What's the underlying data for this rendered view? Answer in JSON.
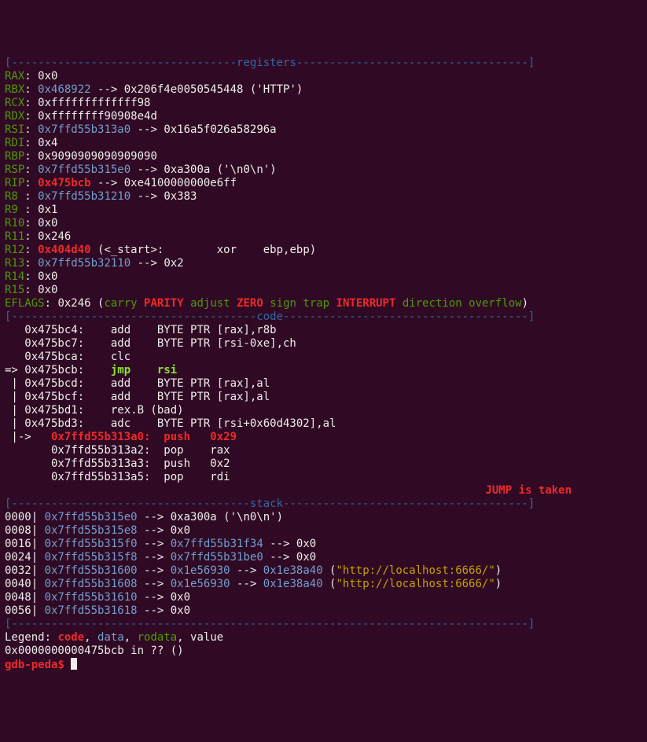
{
  "headers": {
    "registers": "registers",
    "code": "code",
    "stack": "stack"
  },
  "registers": [
    {
      "name": "RAX",
      "sep": ": ",
      "plain": "0x0"
    },
    {
      "name": "RBX",
      "sep": ": ",
      "addr": "0x468922",
      "tail": " --> 0x206f4e0050545448 ('HTTP')"
    },
    {
      "name": "RCX",
      "sep": ": ",
      "plain": "0xfffffffffffff98"
    },
    {
      "name": "RDX",
      "sep": ": ",
      "plain": "0xffffffff90908e4d"
    },
    {
      "name": "RSI",
      "sep": ": ",
      "addr": "0x7ffd55b313a0",
      "tail": " --> 0x16a5f026a58296a"
    },
    {
      "name": "RDI",
      "sep": ": ",
      "plain": "0x4"
    },
    {
      "name": "RBP",
      "sep": ": ",
      "plain": "0x9090909090909090"
    },
    {
      "name": "RSP",
      "sep": ": ",
      "addr": "0x7ffd55b315e0",
      "tail": " --> 0xa300a ('\\n0\\n')"
    },
    {
      "name": "RIP",
      "sep": ": ",
      "red": "0x475bcb",
      "tail": " --> 0xe4100000000e6ff"
    },
    {
      "name": "R8 ",
      "sep": ": ",
      "addr": "0x7ffd55b31210",
      "tail": " --> 0x383"
    },
    {
      "name": "R9 ",
      "sep": ": ",
      "plain": "0x1"
    },
    {
      "name": "R10",
      "sep": ": ",
      "plain": "0x0"
    },
    {
      "name": "R11",
      "sep": ": ",
      "plain": "0x246"
    },
    {
      "name": "R12",
      "sep": ": ",
      "red": "0x404d40",
      "tail": " (<_start>:        xor    ebp,ebp)"
    },
    {
      "name": "R13",
      "sep": ": ",
      "addr": "0x7ffd55b32110",
      "tail": " --> 0x2"
    },
    {
      "name": "R14",
      "sep": ": ",
      "plain": "0x0"
    },
    {
      "name": "R15",
      "sep": ": ",
      "plain": "0x0"
    }
  ],
  "eflags": {
    "label": "EFLAGS",
    "value": "0x246",
    "open": " (",
    "carry": "carry",
    "parity": "PARITY",
    "adjust": "adjust",
    "zero": "ZERO",
    "sign": "sign",
    "trap": "trap",
    "interrupt": "INTERRUPT",
    "direction": "direction",
    "overflow": "overflow",
    "close": ")"
  },
  "code": {
    "l0": "   0x475bc4:    add    BYTE PTR [rax],r8b",
    "l1": "   0x475bc7:    add    BYTE PTR [rsi-0xe],ch",
    "l2": "   0x475bca:    clc",
    "cur_arrow": "=> ",
    "cur_addr": "0x475bcb:    ",
    "cur_op": "jmp    ",
    "cur_arg": "rsi",
    "l4": " | 0x475bcd:    add    BYTE PTR [rax],al",
    "l5": " | 0x475bcf:    add    BYTE PTR [rax],al",
    "l6": " | 0x475bd1:    rex.B (bad)",
    "l7": " | 0x475bd3:    adc    BYTE PTR [rsi+0x60d4302],al",
    "j_arrow": " |->   ",
    "j_inst": "0x7ffd55b313a0:  push   0x29",
    "l9": "       0x7ffd55b313a2:  pop    rax",
    "l10": "       0x7ffd55b313a3:  push   0x2",
    "l11": "       0x7ffd55b313a5:  pop    rdi",
    "jump": "JUMP is taken"
  },
  "stack": [
    {
      "off": "0000| ",
      "addr": "0x7ffd55b315e0",
      "a": " --> 0xa300a ('\\n0\\n')"
    },
    {
      "off": "0008| ",
      "addr": "0x7ffd55b315e8",
      "a": " --> 0x0"
    },
    {
      "off": "0016| ",
      "addr": "0x7ffd55b315f0",
      "a": " --> ",
      "addr2": "0x7ffd55b31f34",
      "b": " --> 0x0"
    },
    {
      "off": "0024| ",
      "addr": "0x7ffd55b315f8",
      "a": " --> ",
      "addr2": "0x7ffd55b31be0",
      "b": " --> 0x0"
    },
    {
      "off": "0032| ",
      "addr": "0x7ffd55b31600",
      "a": " --> ",
      "addr2": "0x1e56930",
      "b": " --> ",
      "addr3": "0x1e38a40",
      "c": " (",
      "str": "\"http://localhost:6666/\"",
      "d": ")"
    },
    {
      "off": "0040| ",
      "addr": "0x7ffd55b31608",
      "a": " --> ",
      "addr2": "0x1e56930",
      "b": " --> ",
      "addr3": "0x1e38a40",
      "c": " (",
      "str": "\"http://localhost:6666/\"",
      "d": ")"
    },
    {
      "off": "0048| ",
      "addr": "0x7ffd55b31610",
      "a": " --> 0x0"
    },
    {
      "off": "0056| ",
      "addr": "0x7ffd55b31618",
      "a": " --> 0x0"
    }
  ],
  "legend": {
    "label": "Legend: ",
    "code": "code",
    "data": "data",
    "rodata": "rodata",
    "value": ", value"
  },
  "loc": "0x0000000000475bcb in ?? ()",
  "prompt": {
    "p": "gdb-peda",
    "d": "$ "
  },
  "dash": {
    "reg_l": "[----------------------------------",
    "reg_r": "-----------------------------------]",
    "code_l": "[-------------------------------------",
    "code_r": "-------------------------------------]",
    "stack_l": "[------------------------------------",
    "stack_r": "-------------------------------------]",
    "end": "[------------------------------------------------------------------------------]"
  }
}
